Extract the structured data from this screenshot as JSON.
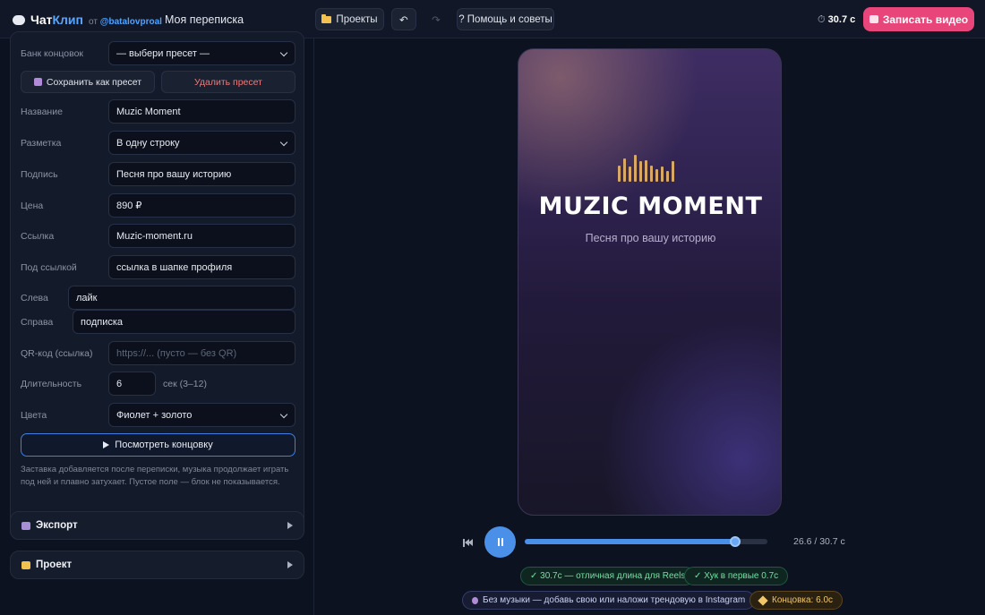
{
  "app": {
    "name_prefix": "Чат",
    "name_accent": "Клип",
    "by_prefix": "от",
    "by_handle": "@batalovproal",
    "page_title": "Моя переписка"
  },
  "toolbar": {
    "projects_label": "Проекты",
    "undo_label": "↶",
    "redo_label": "↷",
    "help_label": "? Помощь и советы",
    "timer_icon": "⏱",
    "timer_value": "30.7 с",
    "record_label": "Записать видео"
  },
  "outro": {
    "bank_label": "Банк концовок",
    "bank_value": "— выбери пресет —",
    "save_preset_label": "Сохранить как пресет",
    "delete_preset_label": "Удалить пресет",
    "name_label": "Название",
    "name_value": "Muzic Moment",
    "layout_label": "Разметка",
    "layout_value": "В одну строку",
    "caption_label": "Подпись",
    "caption_value": "Песня про вашу историю",
    "price_label": "Цена",
    "price_value": "890 ₽",
    "link_label": "Ссылка",
    "link_value": "Muzic-moment.ru",
    "under_link_label": "Под ссылкой",
    "under_link_value": "ссылка в шапке профиля",
    "left_label": "Слева",
    "left_value": "лайк",
    "right_label": "Справа",
    "right_value": "подписка",
    "qr_label": "QR-код (ссылка)",
    "qr_placeholder": "https://... (пусто — без QR)",
    "duration_label": "Длительность",
    "duration_value": "6",
    "duration_hint": "сек (3–12)",
    "colors_label": "Цвета",
    "colors_value": "Фиолет + золото",
    "preview_label": "Посмотреть концовку",
    "hint": "Заставка добавляется после переписки, музыка продолжает играть под ней и плавно затухает. Пустое поле — блок не показывается."
  },
  "sections": {
    "export_label": "Экспорт",
    "project_label": "Проект"
  },
  "preview": {
    "title": "MUZIC MOMENT",
    "subtitle": "Песня про вашу историю",
    "eq_levels": [
      0.6,
      0.85,
      0.55,
      1.0,
      0.75,
      0.8,
      0.6,
      0.45,
      0.55,
      0.4,
      0.75
    ],
    "accent_color": "#d9a864"
  },
  "player": {
    "progress": 0.866,
    "time_readout": "26.6 / 30.7 с"
  },
  "badges": {
    "length": "✓ 30.7с — отличная длина для Reels",
    "hook": "✓ Хук в первые 0.7с",
    "music": "Без музыки — добавь свою или наложи трендовую в Instagram",
    "outro": "Концовка: 6.0с"
  }
}
